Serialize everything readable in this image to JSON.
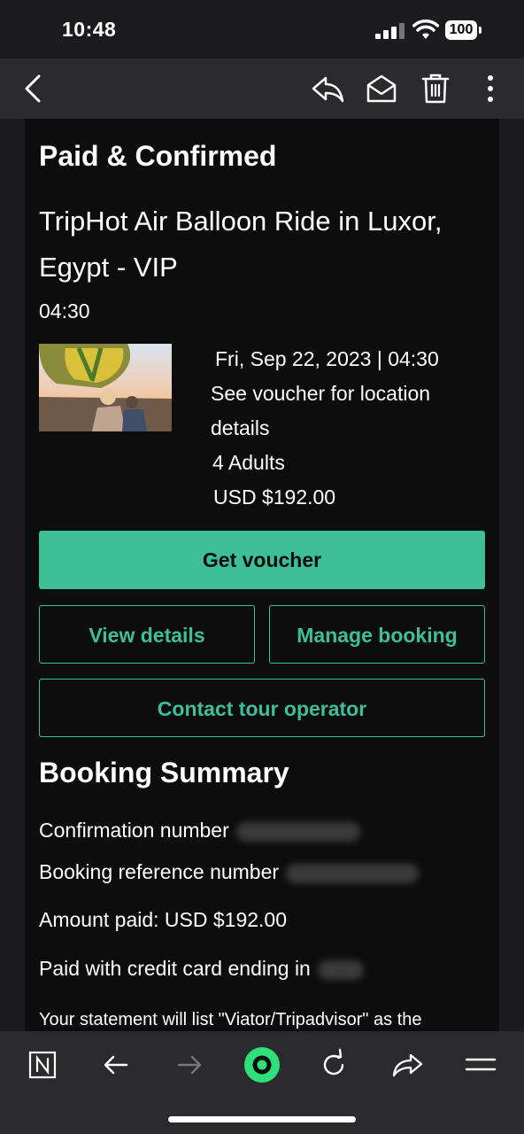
{
  "status_bar": {
    "time": "10:48",
    "battery": "100"
  },
  "header": {
    "back_icon": "chevron-left-icon",
    "reply_icon": "reply-icon",
    "mail_icon": "envelope-open-icon",
    "delete_icon": "trash-icon",
    "more_icon": "more-vertical-icon"
  },
  "email": {
    "heading": "Paid & Confirmed",
    "tour_title": "TripHot Air Balloon Ride in Luxor, Egypt - VIP",
    "tour_time": "04:30",
    "date_time": "Fri, Sep 22, 2023 | 04:30",
    "location_line1": "See voucher for location",
    "location_line2": "details",
    "travelers": "4 Adults",
    "price": "USD $192.00",
    "buttons": {
      "get_voucher": "Get voucher",
      "view_details": "View details",
      "manage_booking": "Manage booking",
      "contact_operator": "Contact tour operator"
    },
    "summary": {
      "heading": "Booking Summary",
      "confirmation_label": "Confirmation number",
      "booking_reference_label": "Booking reference number",
      "amount_paid": "Amount paid: USD $192.00",
      "card_label": "Paid with credit card ending in",
      "statement": "Your statement will list \"Viator/Tripadvisor\" as the"
    }
  },
  "bottom_bar": {
    "icons": [
      "notion-icon",
      "back-arrow-icon",
      "forward-arrow-icon",
      "home-circle-icon",
      "refresh-icon",
      "share-icon",
      "menu-icon"
    ]
  },
  "colors": {
    "accent": "#3fbf97",
    "background": "#0d0d0d",
    "toolbar": "#2b2b2d",
    "home_button": "#2fe07a"
  }
}
